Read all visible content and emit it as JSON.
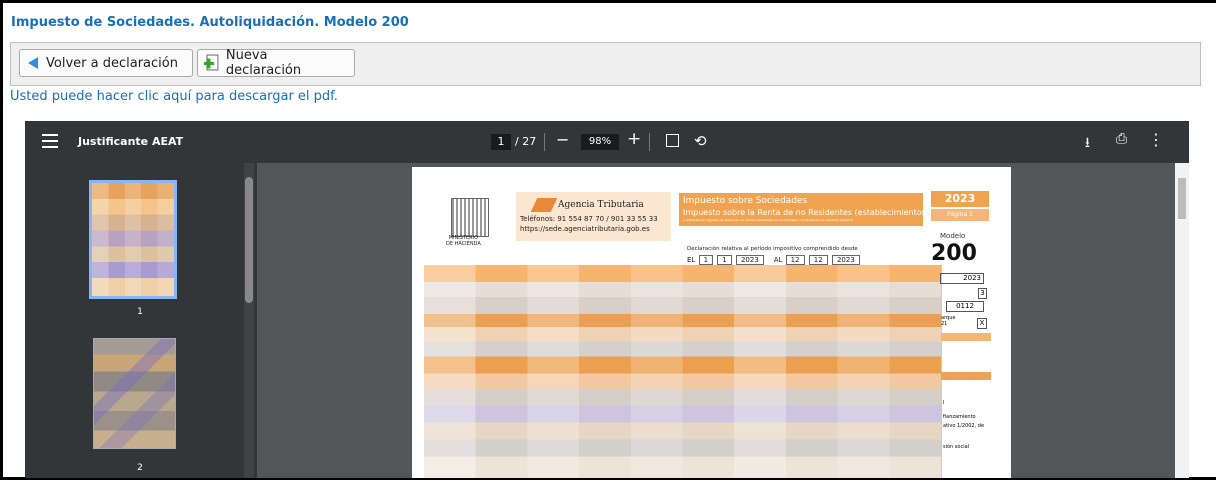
{
  "page_title": "Impuesto de Sociedades. Autoliquidación. Modelo 200",
  "toolbar": {
    "back_label": "Volver a declaración",
    "new_label": "Nueva declaración"
  },
  "pdf_link": "Usted puede hacer clic aquí para descargar el pdf.",
  "viewer": {
    "doc_title": "Justificante AEAT",
    "current_page": "1",
    "total_pages": "/ 27",
    "zoom": "98%",
    "zoom_out": "−",
    "zoom_in": "+",
    "rotate_icon": "⟲",
    "download_icon": "⭳",
    "print_icon": "⎙",
    "more_icon": "⋮",
    "thumb1_label": "1",
    "thumb2_label": "2"
  },
  "document": {
    "ministry": "MINISTERIO\nDE HACIENDA",
    "agency_name": "Agencia Tributaria",
    "phones": "Teléfonos: 91 554 87 70 / 901 33 55 33",
    "website": "https://sede.agenciatributaria.gob.es",
    "tax_line1": "Impuesto sobre Sociedades",
    "tax_line2": "Impuesto sobre la Renta de no Residentes (establecimientos permanentes",
    "tax_line3": "y entidades en régimen de atribución de rentas constituidas en el extranjero con presencia en territorio español)",
    "year": "2023",
    "page_label": "Página 1",
    "modelo_label": "Modelo",
    "modelo_num": "200",
    "declaration_text": "Declaración relativa al período impositivo comprendido desde",
    "el": "EL",
    "al": "AL",
    "from_day": "1",
    "from_month": "1",
    "from_year": "2023",
    "to_day": "12",
    "to_month": "12",
    "to_year": "2023",
    "right_year": "2023",
    "right_num": "3",
    "right_code": "0112",
    "right_marque": "arque\n21",
    "right_x": "X",
    "right_text1": "l",
    "right_text2": "fianzamiento",
    "right_text3": "ativo 1/2002, de",
    "right_text4": "sión social"
  }
}
